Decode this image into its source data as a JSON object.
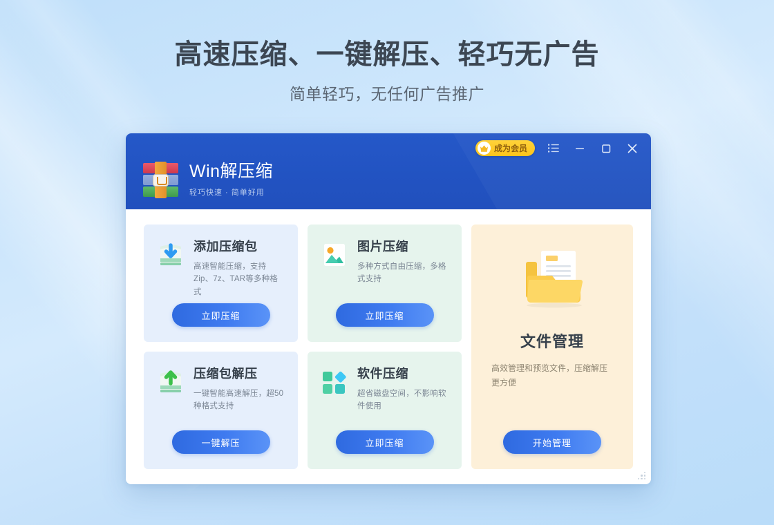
{
  "promo": {
    "headline": "高速压缩、一键解压、轻巧无广告",
    "subhead": "简单轻巧，无任何广告推广"
  },
  "window": {
    "brand_title": "Win解压缩",
    "brand_sub": "轻巧快速 · 简单好用",
    "logo_icon": "winrar-books-icon",
    "member_badge": {
      "label": "成为会员",
      "icon": "crown-icon",
      "bg_color": "#fdc214",
      "text_color": "#8a5a06"
    },
    "controls": [
      {
        "name": "menu-button",
        "icon": "list-menu-icon"
      },
      {
        "name": "minimize-button",
        "icon": "minimize-icon"
      },
      {
        "name": "maximize-button",
        "icon": "maximize-icon"
      },
      {
        "name": "close-button",
        "icon": "close-icon"
      }
    ],
    "titlebar_color": "#2253c2",
    "resize_grip": "resize-grip-icon"
  },
  "cards": [
    {
      "title": "添加压缩包",
      "desc": "高速智能压缩，支持Zip、7z、TAR等多种格式",
      "button": "立即压缩",
      "theme": "blue",
      "icon": "archive-download-icon"
    },
    {
      "title": "图片压缩",
      "desc": "多种方式自由压缩，多格式支持",
      "button": "立即压缩",
      "theme": "green",
      "icon": "photo-image-icon"
    },
    {
      "title": "压缩包解压",
      "desc": "一键智能高速解压，超50种格式支持",
      "button": "一键解压",
      "theme": "blue",
      "icon": "archive-extract-icon"
    },
    {
      "title": "软件压缩",
      "desc": "超省磁盘空间，不影响软件使用",
      "button": "立即压缩",
      "theme": "green",
      "icon": "app-blocks-icon"
    }
  ],
  "panel": {
    "title": "文件管理",
    "desc": "高效管理和预览文件，压缩解压更方便",
    "button": "开始管理",
    "icon": "open-folder-document-icon",
    "bg_color": "#fdf0d9"
  }
}
